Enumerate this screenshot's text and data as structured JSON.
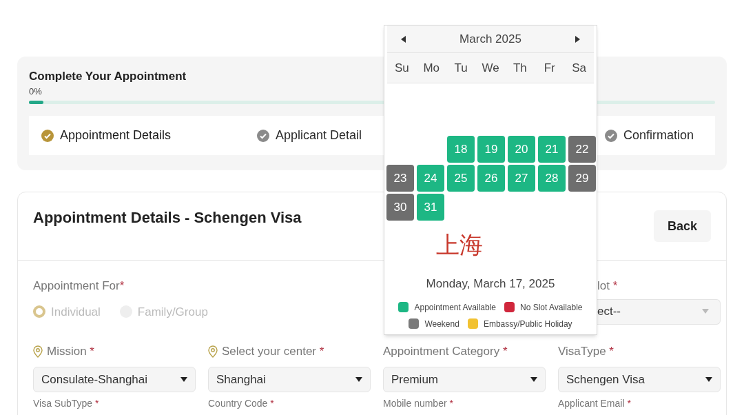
{
  "progress": {
    "title": "Complete Your Appointment",
    "percent": "0%",
    "level": 0,
    "steps": [
      {
        "label": "Appointment Details",
        "selected": true
      },
      {
        "label": "Applicant Detail",
        "selected": false
      },
      {
        "label": "Confirmation",
        "selected": false
      }
    ]
  },
  "form": {
    "title": "Appointment Details - Schengen Visa",
    "back": "Back",
    "appointment_for": {
      "label": "Appointment For",
      "required": "*",
      "disabled": true,
      "options": [
        {
          "label": "Individual",
          "selected": true
        },
        {
          "label": "Family/Group",
          "selected": false
        }
      ]
    },
    "slot": {
      "label": "lot",
      "required": "*",
      "value": "ect--"
    },
    "fields": [
      {
        "label": "Mission",
        "required": "*",
        "value": "Consulate-Shanghai",
        "pin": true
      },
      {
        "label": "Select your center",
        "required": "*",
        "value": "Shanghai",
        "pin": true
      },
      {
        "label": "Appointment Category",
        "required": "*",
        "value": "Premium",
        "pin": false
      },
      {
        "label": "VisaType",
        "required": "*",
        "value": "Schengen Visa",
        "pin": false
      }
    ],
    "more_fields": [
      {
        "label": "Visa SubType",
        "required": "*"
      },
      {
        "label": "Country Code",
        "required": "*"
      },
      {
        "label": "Mobile number",
        "required": "*"
      },
      {
        "label": "Applicant Email",
        "required": "*"
      }
    ]
  },
  "calendar": {
    "month": "March 2025",
    "weekdays": [
      "Su",
      "Mo",
      "Tu",
      "We",
      "Th",
      "Fr",
      "Sa"
    ],
    "days": [
      {
        "day": "18",
        "kind": "available"
      },
      {
        "day": "19",
        "kind": "available"
      },
      {
        "day": "20",
        "kind": "available"
      },
      {
        "day": "21",
        "kind": "available"
      },
      {
        "day": "22",
        "kind": "weekend"
      },
      {
        "day": "23",
        "kind": "weekend"
      },
      {
        "day": "24",
        "kind": "available"
      },
      {
        "day": "25",
        "kind": "available"
      },
      {
        "day": "26",
        "kind": "available"
      },
      {
        "day": "27",
        "kind": "available"
      },
      {
        "day": "28",
        "kind": "available"
      },
      {
        "day": "29",
        "kind": "weekend"
      },
      {
        "day": "30",
        "kind": "weekend"
      },
      {
        "day": "31",
        "kind": "available"
      }
    ],
    "annotation": "上海",
    "selected_date": "Monday, March 17, 2025",
    "legend": [
      {
        "label": "Appointment Available",
        "color": "#1db784"
      },
      {
        "label": "No Slot Available",
        "color": "#d0273c"
      },
      {
        "label": "Weekend",
        "color": "#7a7a7a"
      },
      {
        "label": "Embassy/Public Holiday",
        "color": "#f2c232"
      }
    ]
  }
}
